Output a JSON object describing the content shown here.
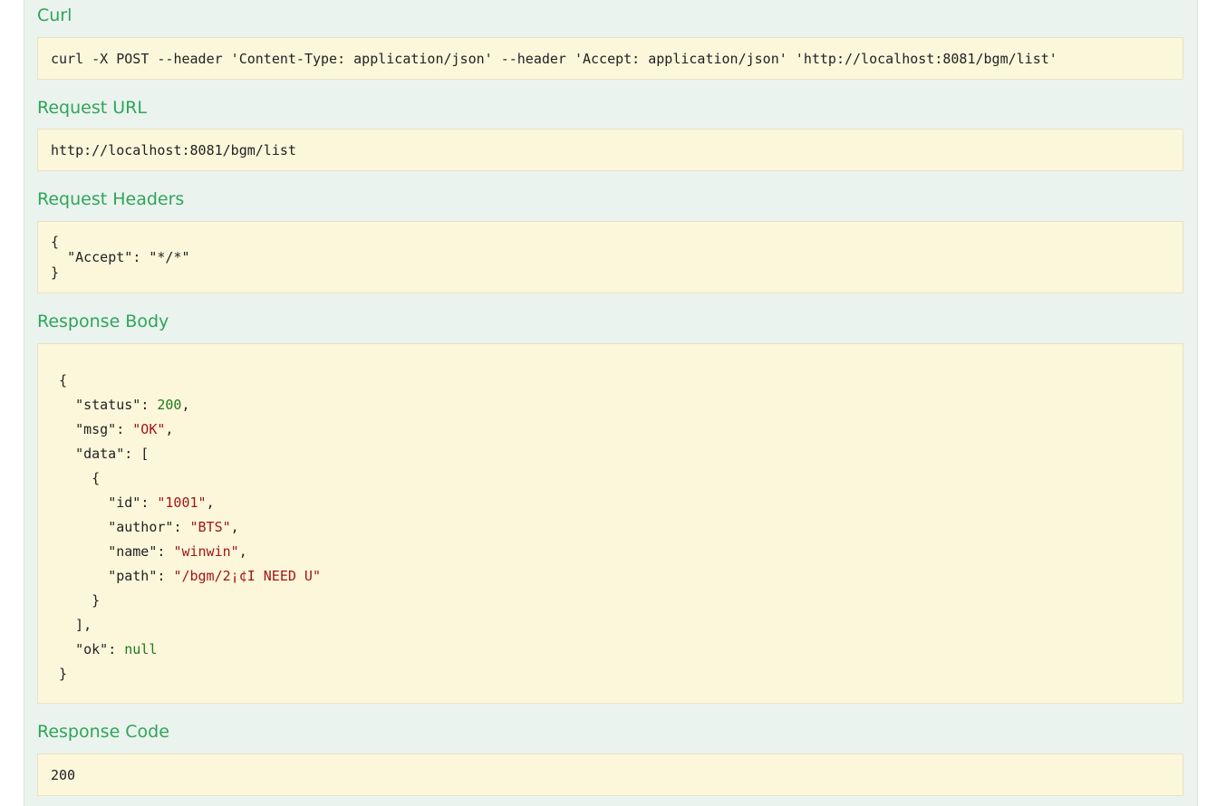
{
  "curl": {
    "title": "Curl",
    "command": "curl -X POST --header 'Content-Type: application/json' --header 'Accept: application/json' 'http://localhost:8081/bgm/list'"
  },
  "request_url": {
    "title": "Request URL",
    "value": "http://localhost:8081/bgm/list"
  },
  "request_headers": {
    "title": "Request Headers",
    "open": "{",
    "accept_key": "\"Accept\"",
    "accept_value": "\"*/*\"",
    "close": "}"
  },
  "response_body": {
    "title": "Response Body",
    "status_key": "\"status\"",
    "status_value": "200",
    "msg_key": "\"msg\"",
    "msg_value": "\"OK\"",
    "data_key": "\"data\"",
    "item": {
      "id_key": "\"id\"",
      "id_value": "\"1001\"",
      "author_key": "\"author\"",
      "author_value": "\"BTS\"",
      "name_key": "\"name\"",
      "name_value": "\"winwin\"",
      "path_key": "\"path\"",
      "path_value": "\"/bgm/2¡¢I NEED U\""
    },
    "ok_key": "\"ok\"",
    "ok_value": "null"
  },
  "response_code": {
    "title": "Response Code",
    "value": "200"
  },
  "colors": {
    "heading": "#2ea55a",
    "panel_bg": "#ebf3ee",
    "code_bg": "#fcf6db",
    "number": "#1c7a1c",
    "string": "#a31515"
  }
}
